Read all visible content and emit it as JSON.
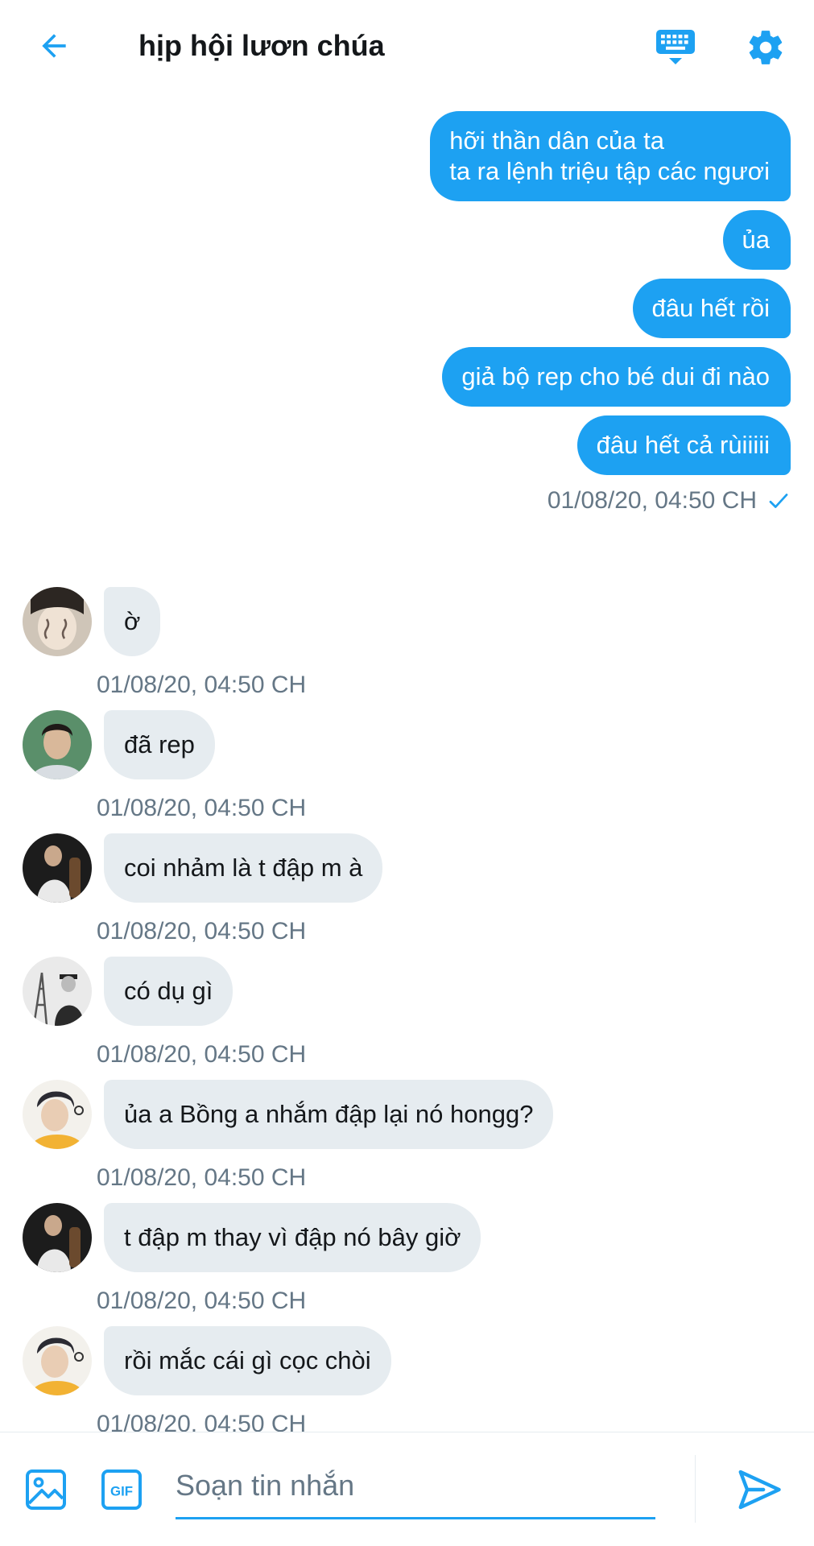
{
  "colors": {
    "accent": "#1da1f2",
    "incoming_bubble": "#e6ecf0",
    "muted_text": "#657786",
    "text": "#14171a"
  },
  "header": {
    "back_icon": "arrow-left-icon",
    "title": "hịp hội lươn chúa",
    "keyboard_icon": "keyboard-icon",
    "settings_icon": "gear-icon"
  },
  "outgoing": {
    "messages": [
      {
        "text": "hỡi thần dân của ta\nta ra lệnh triệu tập các ngươi"
      },
      {
        "text": "ủa"
      },
      {
        "text": "đâu hết rồi"
      },
      {
        "text": "giả bộ rep cho bé dui đi nào"
      },
      {
        "text": "đâu hết cả rùiiiii"
      }
    ],
    "timestamp": "01/08/20, 04:50 CH",
    "status_icon": "check-icon"
  },
  "incoming": [
    {
      "avatar": "avatar-icon",
      "text": "ờ",
      "timestamp": "01/08/20, 04:50 CH"
    },
    {
      "avatar": "avatar-icon",
      "text": "đã rep",
      "timestamp": "01/08/20, 04:50 CH"
    },
    {
      "avatar": "avatar-icon",
      "text": "coi nhảm là t đập m à",
      "timestamp": "01/08/20, 04:50 CH"
    },
    {
      "avatar": "avatar-icon",
      "text": "có dụ gì",
      "timestamp": "01/08/20, 04:50 CH"
    },
    {
      "avatar": "avatar-icon",
      "text": "ủa a Bồng a nhắm đập lại nó hongg?",
      "timestamp": "01/08/20, 04:50 CH"
    },
    {
      "avatar": "avatar-icon",
      "text": "t đập m thay vì đập nó bây giờ",
      "timestamp": "01/08/20, 04:50 CH"
    },
    {
      "avatar": "avatar-icon",
      "text": "rồi mắc cái gì cọc chòi",
      "timestamp": "01/08/20, 04:50 CH"
    }
  ],
  "compose": {
    "image_icon": "image-icon",
    "gif_label": "GIF",
    "placeholder": "Soạn tin nhắn",
    "value": "",
    "send_icon": "send-icon"
  }
}
